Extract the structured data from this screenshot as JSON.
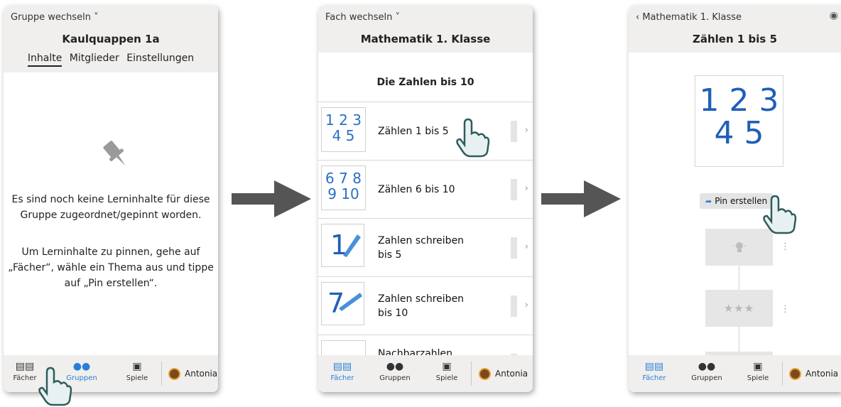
{
  "screen1": {
    "switch_link": "Gruppe wechseln ˅",
    "group_name": "Kaulquappen 1a",
    "tabs": [
      "Inhalte",
      "Mitglieder",
      "Einstellungen"
    ],
    "empty_line1": "Es sind noch keine Lerninhalte für diese",
    "empty_line2": "Gruppe zugeordnet/gepinnt worden.",
    "hint_line1": "Um Lerninhalte zu pinnen, gehe auf",
    "hint_line2": "„Fächer“, wähle ein Thema aus und tippe",
    "hint_line3": "auf „Pin erstellen“.",
    "nav": {
      "faecher": "Fächer",
      "gruppen": "Gruppen",
      "spiele": "Spiele",
      "user": "Antonia"
    }
  },
  "screen2": {
    "switch_link": "Fach wechseln ˅",
    "subject": "Mathematik 1. Klasse",
    "section": "Die Zahlen bis 10",
    "items": [
      {
        "label": "Zählen 1 bis 5",
        "thumb_line1": "1 2 3",
        "thumb_line2": "4 5"
      },
      {
        "label": "Zählen 6 bis 10",
        "thumb_line1": "6 7 8",
        "thumb_line2": "9 10"
      },
      {
        "label": "Zahlen schreiben bis 5",
        "thumb_line1": "1",
        "thumb_line2": ""
      },
      {
        "label": "Zahlen schreiben bis 10",
        "thumb_line1": "7",
        "thumb_line2": ""
      },
      {
        "label": "Nachbarzahlen",
        "thumb_line1": "",
        "thumb_line2": ""
      }
    ],
    "nav": {
      "faecher": "Fächer",
      "gruppen": "Gruppen",
      "spiele": "Spiele",
      "user": "Antonia"
    }
  },
  "screen3": {
    "back_link": "‹ Mathematik 1. Klasse",
    "topic": "Zählen 1 bis 5",
    "big_line1": "1 2 3",
    "big_line2": "4 5",
    "pin_button": "Pin erstellen",
    "stars": "★★★",
    "nav": {
      "faecher": "Fächer",
      "gruppen": "Gruppen",
      "spiele": "Spiele",
      "user": "Antonia"
    }
  },
  "colors": {
    "accent": "#2a7fd4",
    "header_bg": "#f0efee",
    "arrow": "#555555",
    "digits": "#2a6fc4"
  }
}
